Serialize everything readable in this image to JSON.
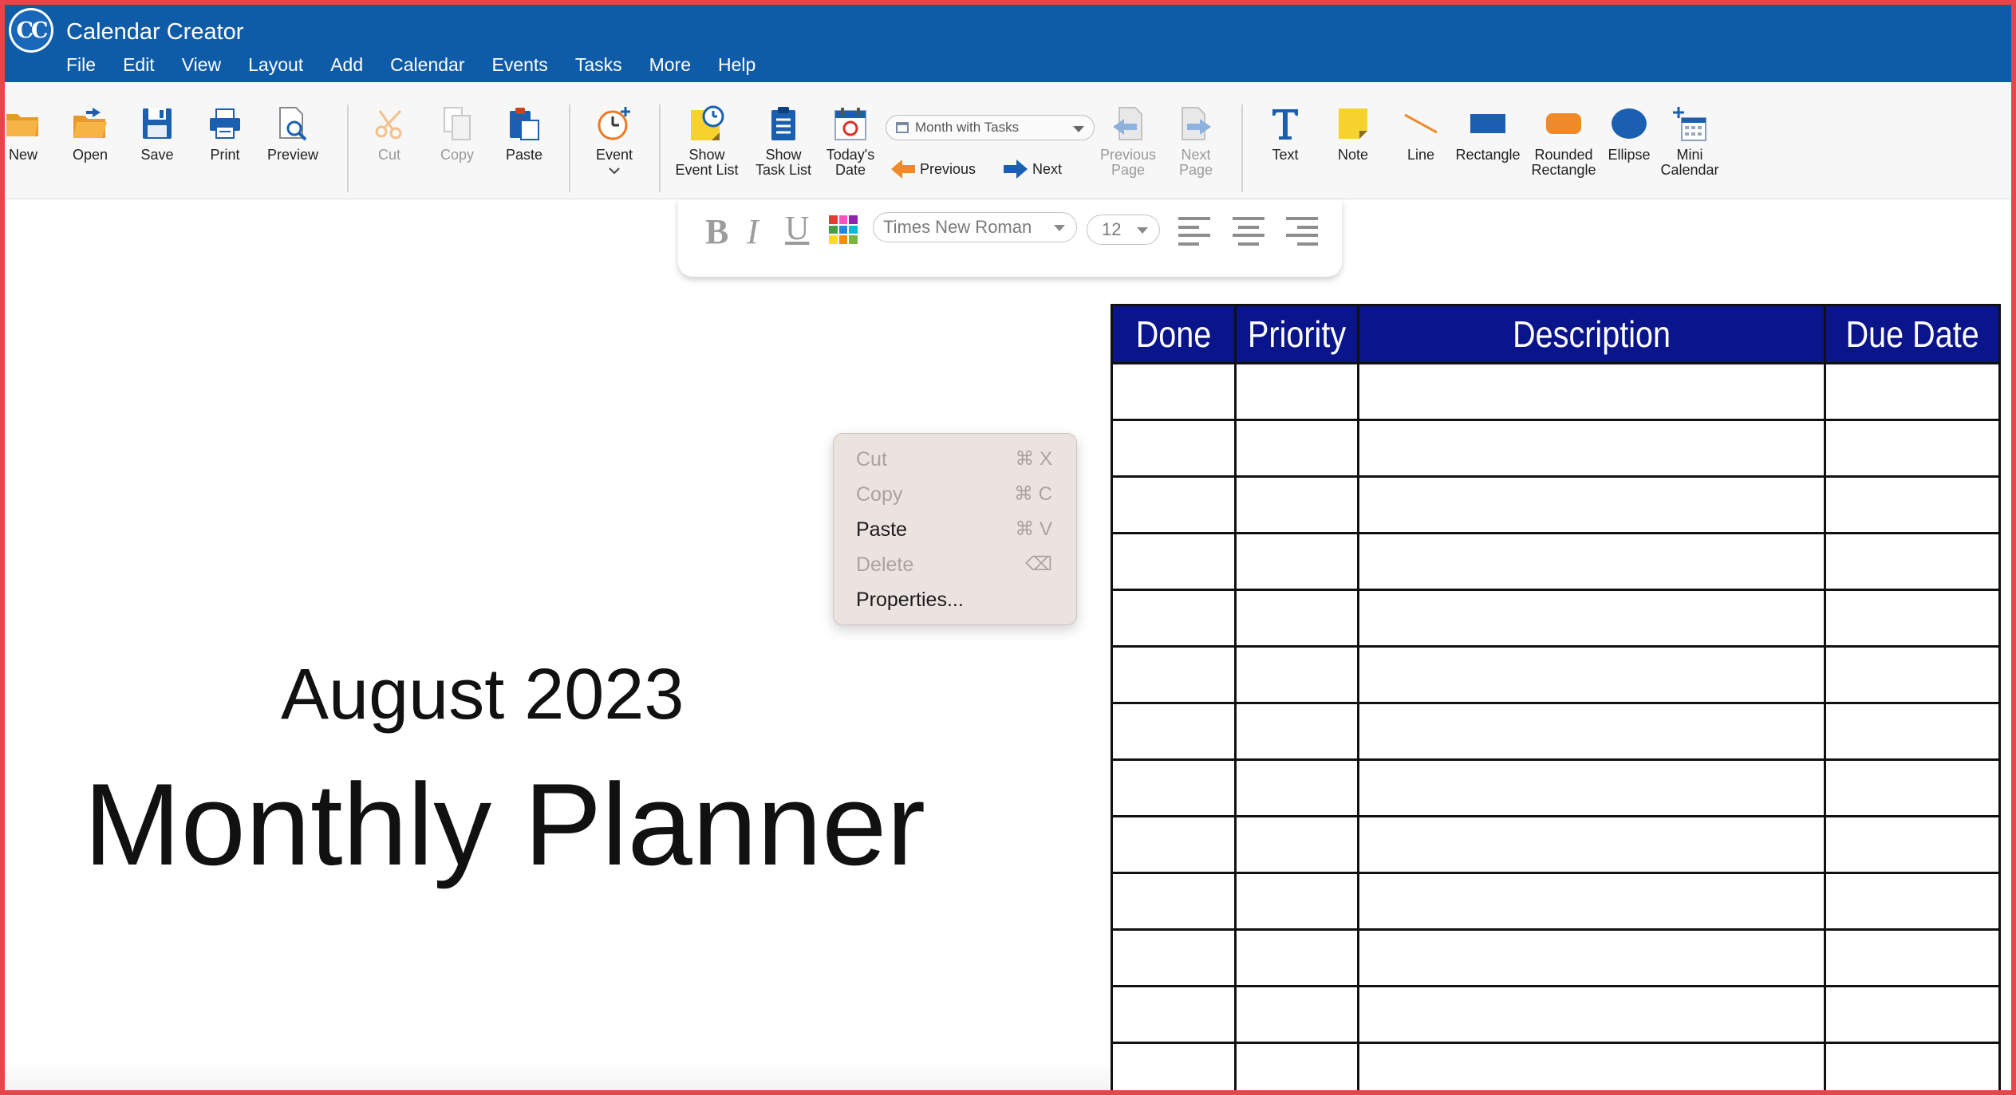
{
  "app": {
    "title": "Calendar Creator",
    "logo_text": "CC"
  },
  "menu": [
    "File",
    "Edit",
    "View",
    "Layout",
    "Add",
    "Calendar",
    "Events",
    "Tasks",
    "More",
    "Help"
  ],
  "toolbar": {
    "new": "New",
    "open": "Open",
    "save": "Save",
    "print": "Print",
    "preview": "Preview",
    "cut": "Cut",
    "copy": "Copy",
    "paste": "Paste",
    "event": "Event",
    "show_event_list": [
      "Show",
      "Event List"
    ],
    "show_task_list": [
      "Show",
      "Task List"
    ],
    "todays_date": [
      "Today's",
      "Date"
    ],
    "view_select": "Month with Tasks",
    "previous": "Previous",
    "next": "Next",
    "previous_page": [
      "Previous",
      "Page"
    ],
    "next_page": [
      "Next",
      "Page"
    ],
    "text": "Text",
    "note": "Note",
    "line": "Line",
    "rectangle": "Rectangle",
    "rounded_rectangle": [
      "Rounded",
      "Rectangle"
    ],
    "ellipse": "Ellipse",
    "mini_calendar": [
      "Mini",
      "Calendar"
    ]
  },
  "format_bar": {
    "bold": "B",
    "italic": "I",
    "underline": "U",
    "font": "Times New Roman",
    "size": "12"
  },
  "page": {
    "month": "August 2023",
    "title": "Monthly Planner"
  },
  "task_table": {
    "headers": [
      "Done",
      "Priority",
      "Description",
      "Due Date"
    ],
    "row_count": 13
  },
  "context_menu": [
    {
      "label": "Cut",
      "shortcut": "⌘ X",
      "enabled": false
    },
    {
      "label": "Copy",
      "shortcut": "⌘ C",
      "enabled": false
    },
    {
      "label": "Paste",
      "shortcut": "⌘ V",
      "enabled": true
    },
    {
      "label": "Delete",
      "shortcut": "⌫",
      "enabled": false
    },
    {
      "label": "Properties...",
      "shortcut": "",
      "enabled": true
    }
  ],
  "colors": {
    "title_bar": "#0e5ba8",
    "table_header": "#0a148b",
    "frame": "#e8454a"
  }
}
